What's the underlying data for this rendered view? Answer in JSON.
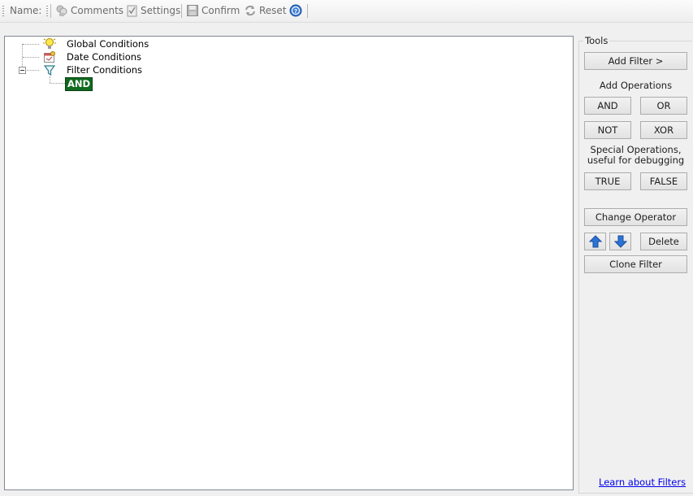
{
  "toolbar": {
    "name_label": "Name:",
    "comments_label": "Comments",
    "settings_label": "Settings",
    "confirm_label": "Confirm",
    "reset_label": "Reset"
  },
  "tree": {
    "nodes": [
      {
        "label": "Global Conditions",
        "icon": "lightbulb-icon"
      },
      {
        "label": "Date Conditions",
        "icon": "calendar-icon"
      },
      {
        "label": "Filter Conditions",
        "icon": "funnel-icon",
        "expanded": true
      }
    ],
    "child": {
      "label": "AND",
      "color": "#106a1e"
    }
  },
  "tools": {
    "title": "Tools",
    "add_filter": "Add Filter >",
    "add_operations": "Add Operations",
    "and": "AND",
    "or": "OR",
    "not": "NOT",
    "xor": "XOR",
    "special_line1": "Special Operations,",
    "special_line2": "useful for debugging",
    "true_label": "TRUE",
    "false_label": "FALSE",
    "change_operator": "Change Operator",
    "delete": "Delete",
    "clone_filter": "Clone Filter",
    "learn_link": "Learn about Filters"
  },
  "colors": {
    "link": "#0000ee",
    "and_badge": "#106a1e",
    "arrow_icons": "#2b73d6"
  }
}
